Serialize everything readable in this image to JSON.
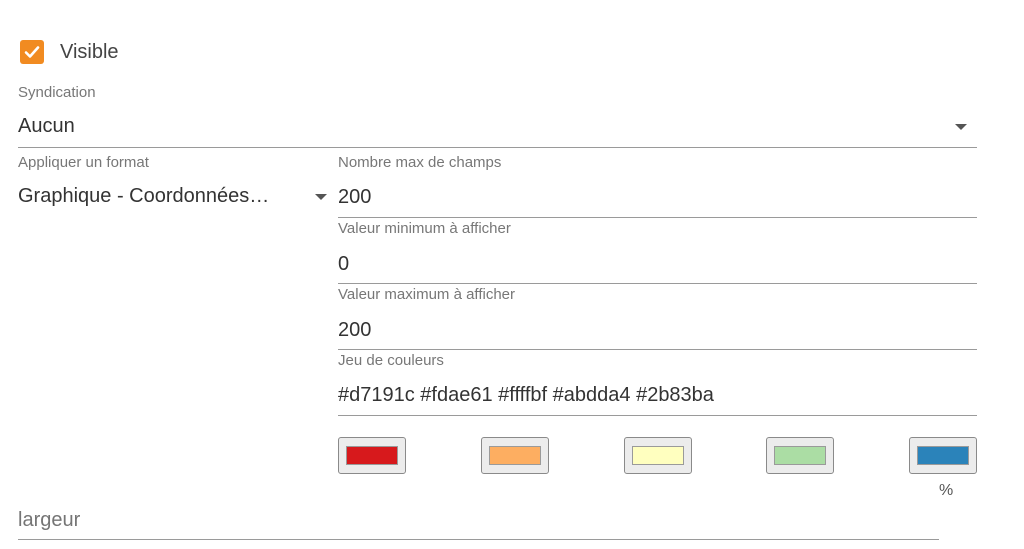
{
  "visible": {
    "label": "Visible",
    "checked": true
  },
  "syndication": {
    "label": "Syndication",
    "value": "Aucun"
  },
  "format": {
    "label": "Appliquer un format",
    "value": "Graphique - Coordonnées…"
  },
  "max_fields": {
    "label": "Nombre max de champs",
    "value": "200"
  },
  "min_value": {
    "label": "Valeur minimum à afficher",
    "value": "0"
  },
  "max_value": {
    "label": "Valeur maximum à afficher",
    "value": "200"
  },
  "color_set": {
    "label": "Jeu de couleurs",
    "value": "#d7191c #fdae61 #ffffbf #abdda4 #2b83ba"
  },
  "swatches": [
    "#d7191c",
    "#fdae61",
    "#ffffbf",
    "#abdda4",
    "#2b83ba"
  ],
  "percent": "%",
  "width_field": {
    "placeholder": "largeur"
  },
  "accent_color": "#f18b21"
}
